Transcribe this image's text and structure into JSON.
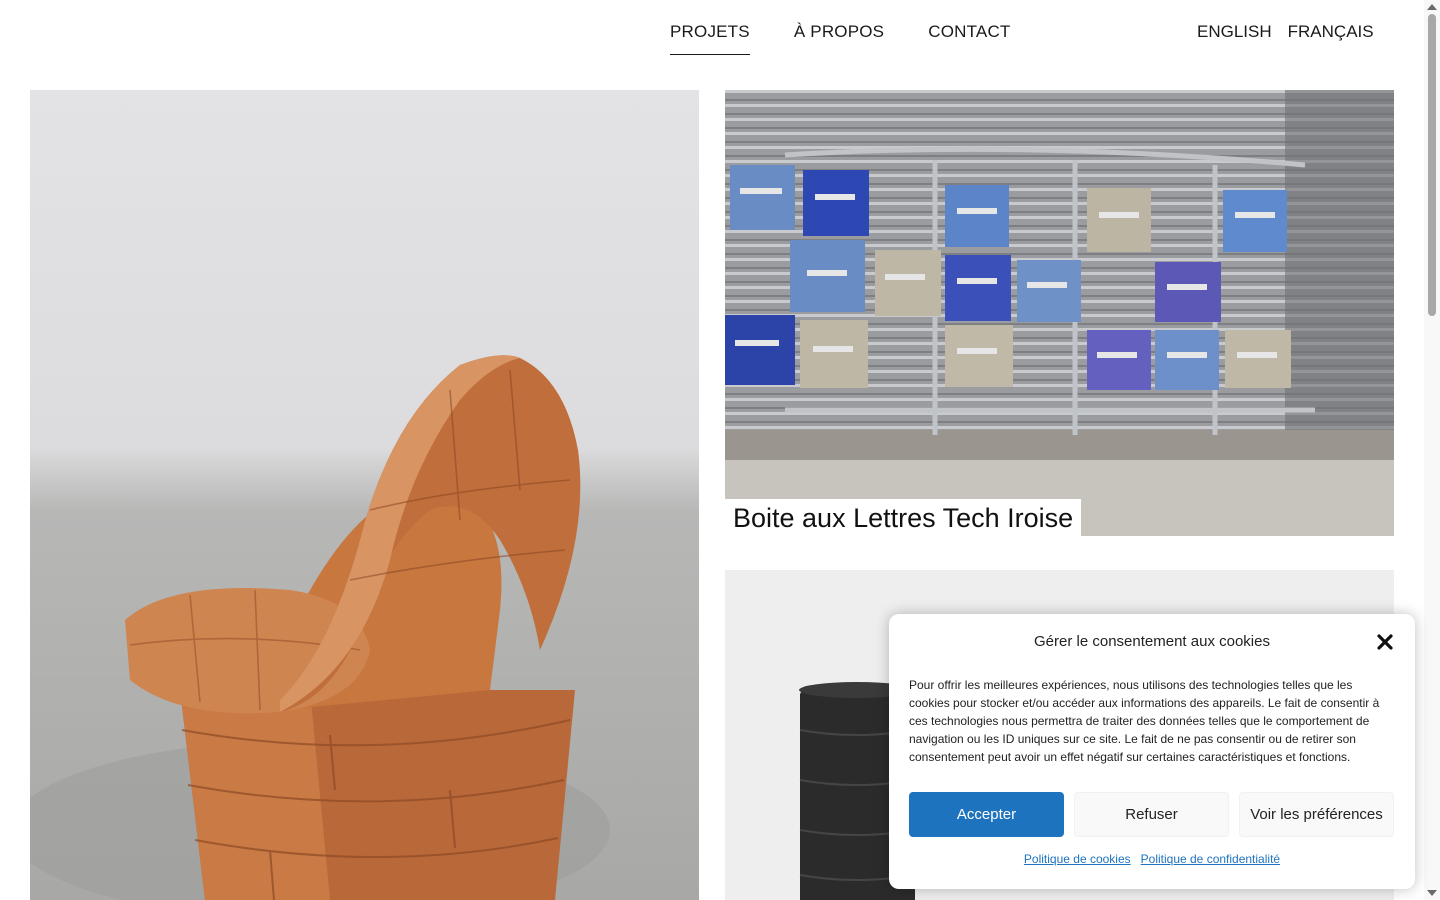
{
  "nav": {
    "items": [
      {
        "label": "PROJETS",
        "active": true
      },
      {
        "label": "À PROPOS",
        "active": false
      },
      {
        "label": "CONTACT",
        "active": false
      }
    ],
    "languages": [
      "ENGLISH",
      "FRANÇAIS"
    ]
  },
  "projects": {
    "featured_caption": "Boite aux Lettres Tech Iroise"
  },
  "cookie": {
    "title": "Gérer le consentement aux cookies",
    "text": "Pour offrir les meilleures expériences, nous utilisons des technologies telles que les cookies pour stocker et/ou accéder aux informations des appareils. Le fait de consentir à ces technologies nous permettra de traiter des données telles que le comportement de navigation ou les ID uniques sur ce site. Le fait de ne pas consentir ou de retirer son consentement peut avoir un effet négatif sur certaines caractéristiques et fonctions.",
    "accept_label": "Accepter",
    "refuse_label": "Refuser",
    "prefs_label": "Voir les préférences",
    "links": [
      "Politique de cookies",
      "Politique de confidentialité"
    ],
    "accent_color": "#1e73be"
  },
  "icons": {
    "close": "close-icon"
  }
}
